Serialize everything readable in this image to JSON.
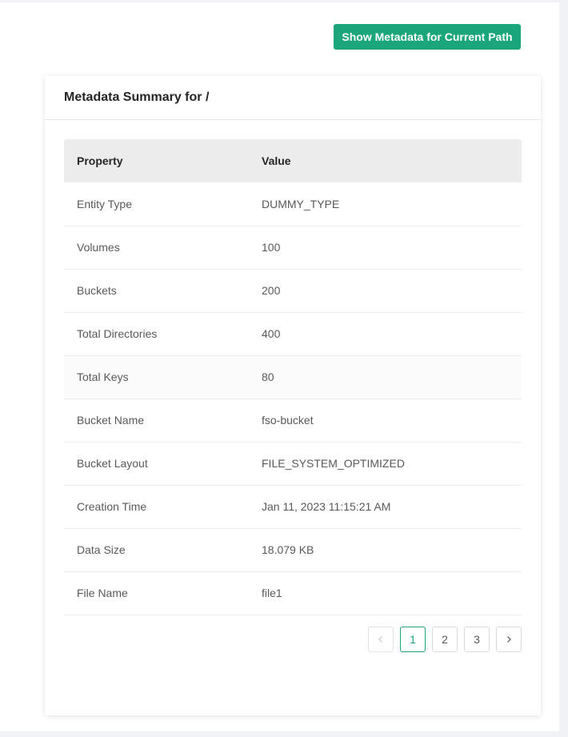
{
  "toolbar": {
    "show_metadata_label": "Show Metadata for Current Path"
  },
  "card": {
    "title": "Metadata Summary for /"
  },
  "table": {
    "headers": {
      "property": "Property",
      "value": "Value"
    },
    "rows": [
      {
        "property": "Entity Type",
        "value": "DUMMY_TYPE"
      },
      {
        "property": "Volumes",
        "value": "100"
      },
      {
        "property": "Buckets",
        "value": "200"
      },
      {
        "property": "Total Directories",
        "value": "400"
      },
      {
        "property": "Total Keys",
        "value": "80"
      },
      {
        "property": "Bucket Name",
        "value": "fso-bucket"
      },
      {
        "property": "Bucket Layout",
        "value": "FILE_SYSTEM_OPTIMIZED"
      },
      {
        "property": "Creation Time",
        "value": "Jan 11, 2023 11:15:21 AM"
      },
      {
        "property": "Data Size",
        "value": "18.079 KB"
      },
      {
        "property": "File Name",
        "value": "file1"
      }
    ]
  },
  "pagination": {
    "pages": [
      "1",
      "2",
      "3"
    ],
    "current_page": "1",
    "prev_icon": "chevron-left-icon",
    "next_icon": "chevron-right-icon"
  },
  "colors": {
    "accent": "#1aa57a",
    "header_bg": "#ececec"
  }
}
